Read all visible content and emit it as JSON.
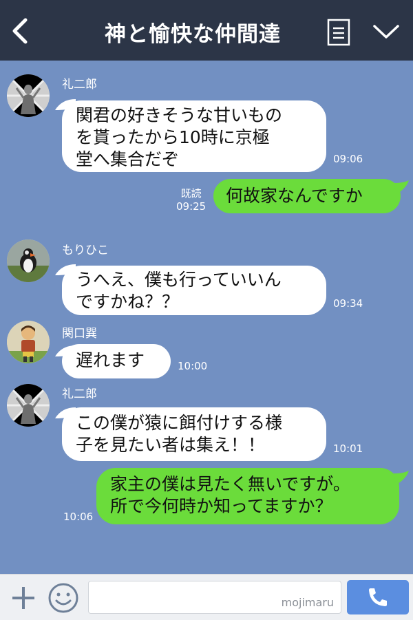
{
  "header": {
    "title": "神と愉快な仲間達",
    "back_icon": "chevron-left-icon",
    "menu_icon": "notes-icon",
    "dropdown_icon": "chevron-down-icon"
  },
  "messages": [
    {
      "sender": "礼二郎",
      "lines": [
        "関君の好きそうな甘いもの",
        "を貰ったから10時に京極",
        "堂へ集合だぞ"
      ],
      "time": "09:06",
      "direction": "in"
    },
    {
      "lines": [
        "何故家なんですか"
      ],
      "read": "既読",
      "time": "09:25",
      "direction": "out"
    },
    {
      "sender": "もりひこ",
      "lines": [
        "うへえ、僕も行っていいん",
        "ですかね？？"
      ],
      "time": "09:34",
      "direction": "in"
    },
    {
      "sender": "関口巽",
      "lines": [
        "遅れます"
      ],
      "time": "10:00",
      "direction": "in"
    },
    {
      "sender": "礼二郎",
      "lines": [
        "この僕が猿に餌付けする様",
        "子を見たい者は集え！！"
      ],
      "time": "10:01",
      "direction": "in"
    },
    {
      "lines": [
        "家主の僕は見たく無いですが。",
        "所で今何時か知ってますか？"
      ],
      "time": "10:06",
      "direction": "out"
    }
  ],
  "input_bar": {
    "watermark": "mojimaru",
    "plus_icon": "plus-icon",
    "emoji_icon": "smiley-icon",
    "call_icon": "phone-icon"
  },
  "colors": {
    "header_bg": "#2c3547",
    "chat_bg": "#7290c2",
    "incoming_bubble": "#ffffff",
    "outgoing_bubble": "#6bdc3b",
    "call_button": "#5b8ee0"
  }
}
